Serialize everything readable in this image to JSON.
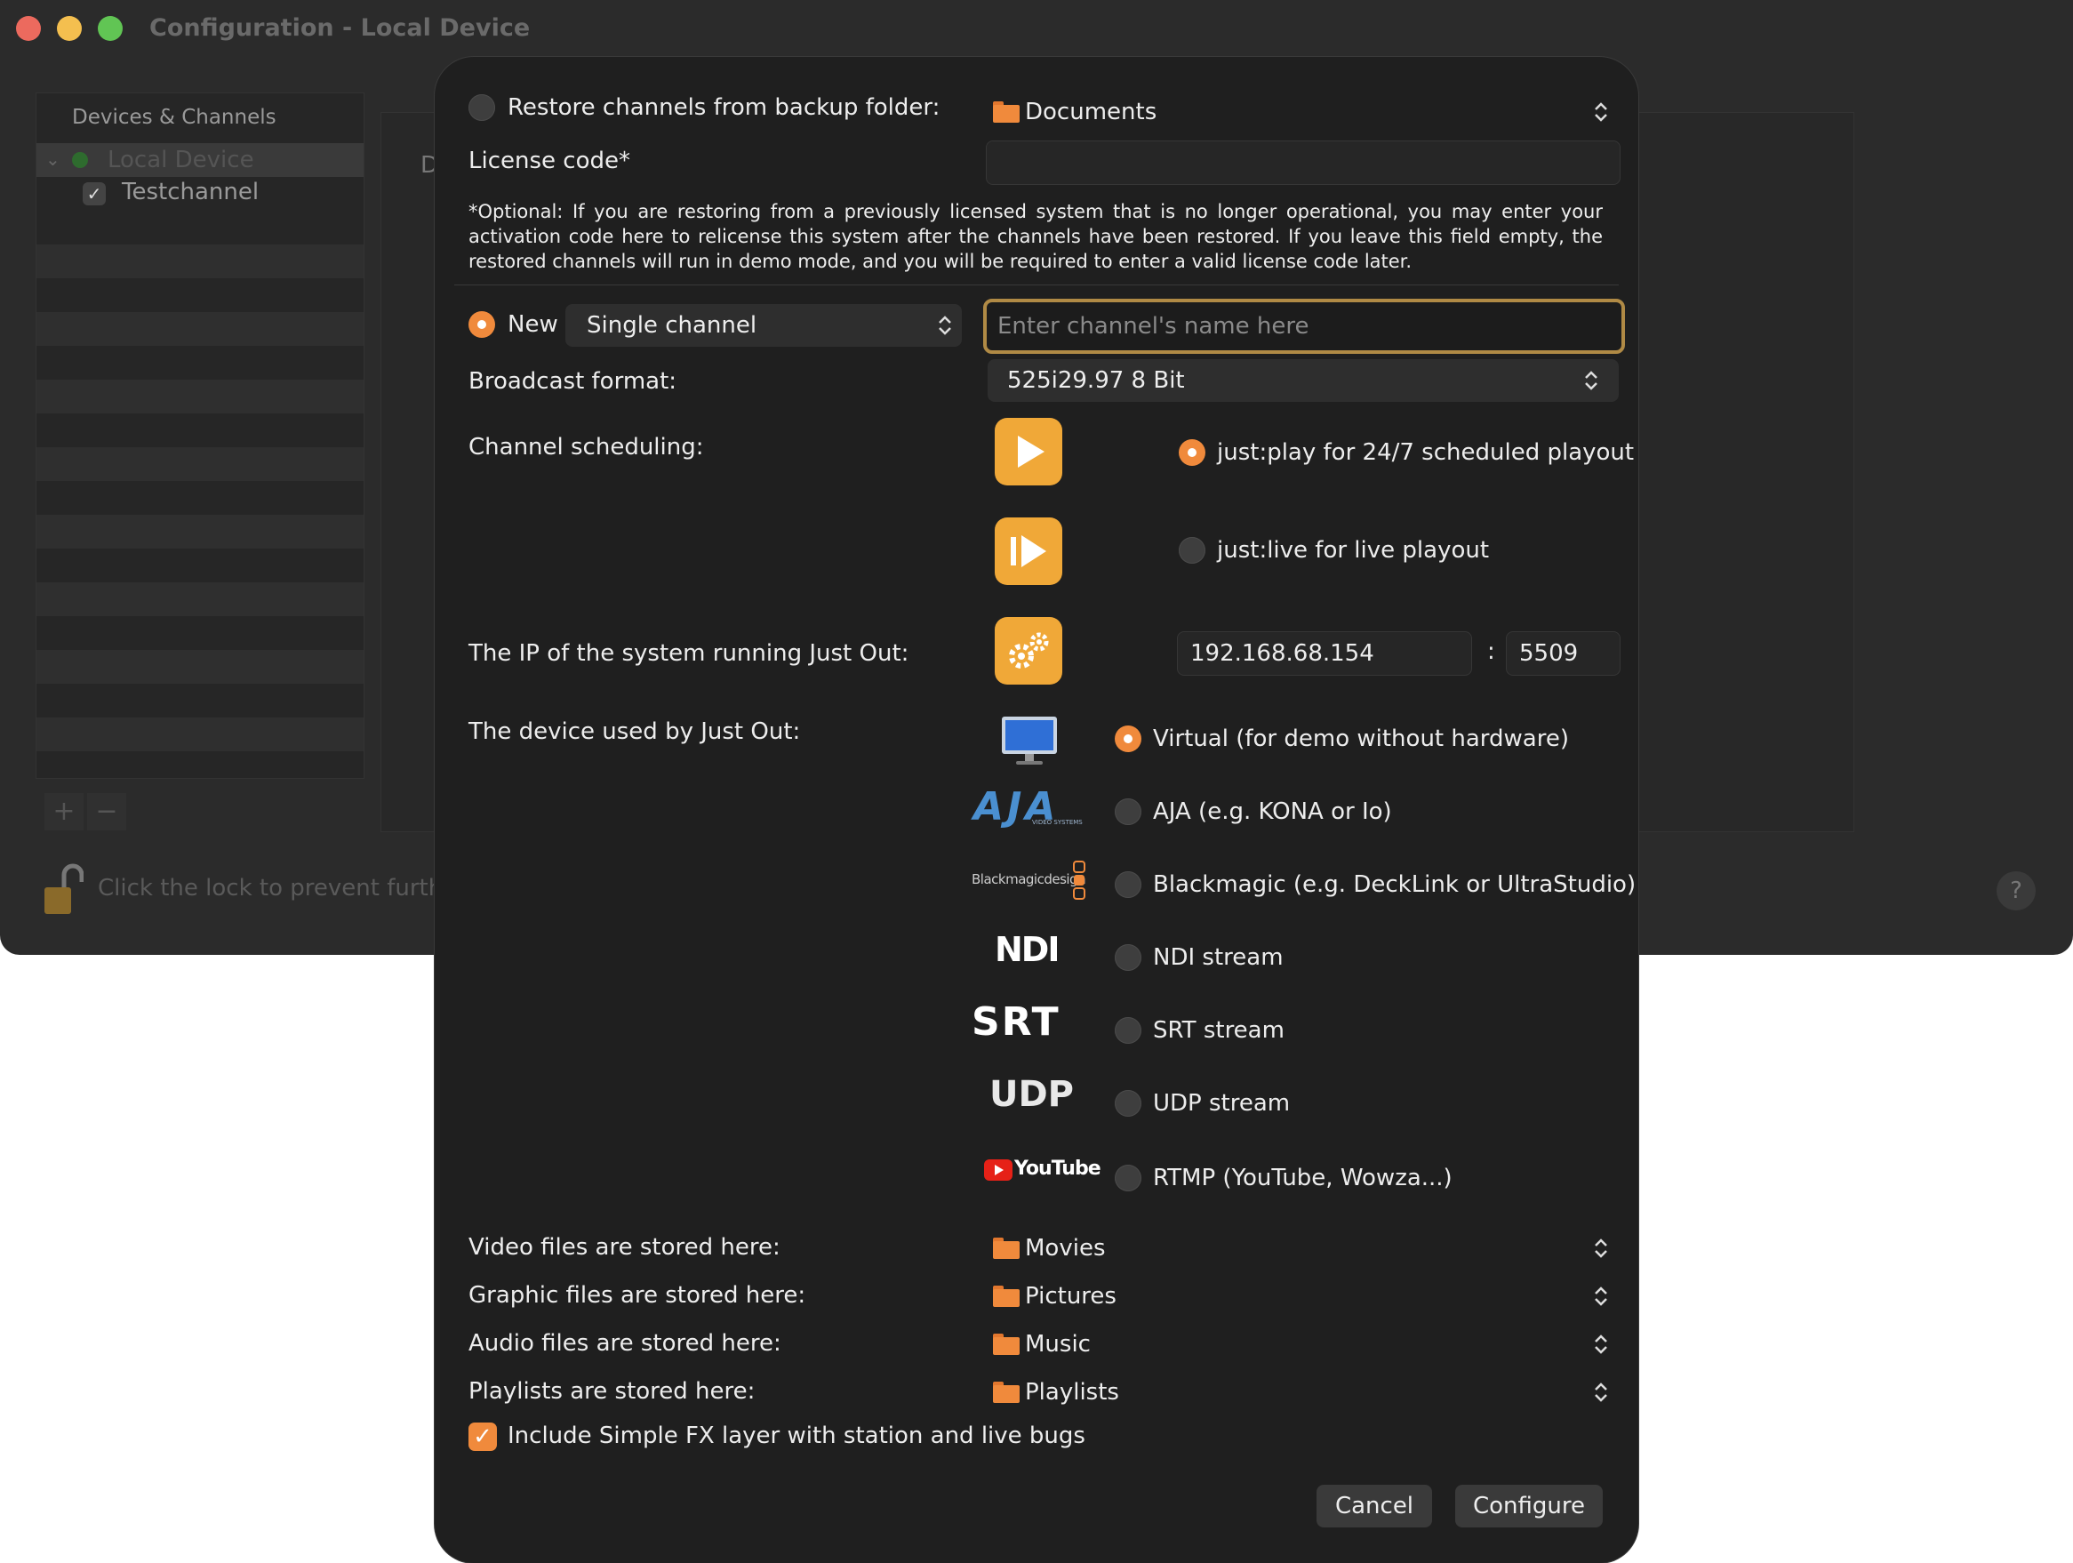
{
  "window": {
    "title": "Configuration - Local Device",
    "traffic_colors": [
      "#ec6a5e",
      "#f4bf4f",
      "#61c554"
    ]
  },
  "sidebar": {
    "header": "Devices & Channels",
    "device": "Local Device",
    "channel": "Testchannel",
    "add_label": "+",
    "remove_label": "−"
  },
  "main": {
    "partial_label": "D"
  },
  "lock": {
    "text": "Click the lock to prevent further"
  },
  "help": {
    "label": "?"
  },
  "sheet": {
    "restore_label": "Restore channels from backup folder:",
    "restore_folder": "Documents",
    "license_label": "License code*",
    "license_value": "",
    "note": "*Optional: If you are restoring from a previously licensed system that is no longer operational, you may enter your activation code here to relicense this system after the channels have been restored. If you leave this field empty, the restored channels will run in demo mode, and you will be required to enter a valid license code later.",
    "new_label": "New",
    "channel_type": "Single channel",
    "channel_name_placeholder": "Enter channel's name here",
    "broadcast_label": "Broadcast format:",
    "broadcast_value": "525i29.97 8 Bit",
    "scheduling_label": "Channel scheduling:",
    "justplay_label": "just:play for 24/7 scheduled playout",
    "justlive_label": "just:live for live playout",
    "ip_label": "The IP of the system running Just Out:",
    "ip_value": "192.168.68.154",
    "port_sep": ":",
    "port_value": "5509",
    "device_label": "The device used by Just Out:",
    "devices": [
      {
        "label": "Virtual (for demo without hardware)",
        "selected": true
      },
      {
        "label": "AJA (e.g. KONA or Io)",
        "selected": false
      },
      {
        "label": "Blackmagic (e.g. DeckLink or UltraStudio)",
        "selected": false
      },
      {
        "label": "NDI stream",
        "selected": false
      },
      {
        "label": "SRT stream",
        "selected": false
      },
      {
        "label": "UDP stream",
        "selected": false
      },
      {
        "label": "RTMP (YouTube, Wowza...)",
        "selected": false
      }
    ],
    "logos": {
      "aja": "AJA",
      "aja_sub": "VIDEO SYSTEMS",
      "blackmagic": "Blackmagicdesign",
      "ndi": "NDI",
      "srt": "SRT",
      "udp": "UDP",
      "youtube": "YouTube"
    },
    "storage": [
      {
        "label": "Video files are stored here:",
        "folder": "Movies"
      },
      {
        "label": "Graphic files are stored here:",
        "folder": "Pictures"
      },
      {
        "label": "Audio files are stored here:",
        "folder": "Music"
      },
      {
        "label": "Playlists are stored here:",
        "folder": "Playlists"
      }
    ],
    "fx_label": "Include Simple FX layer with station and live bugs",
    "fx_checked": true,
    "cancel": "Cancel",
    "configure": "Configure"
  },
  "colors": {
    "accent": "#f08a3c",
    "app_icon": "#f0a838",
    "focus_ring": "#b08a45"
  }
}
